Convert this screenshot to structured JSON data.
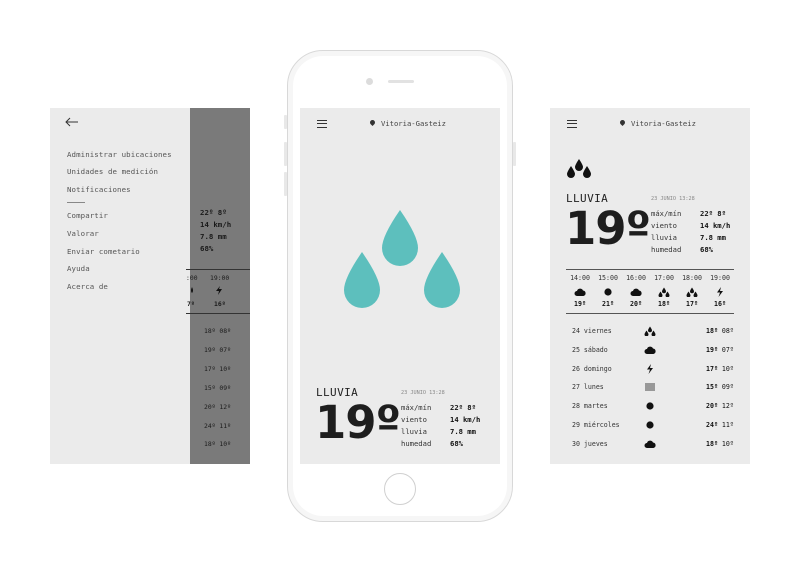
{
  "colors": {
    "drop_teal": "#5dbfbd",
    "screen_bg": "#ebebeb",
    "overlay": "#7a7a7a"
  },
  "icons": {
    "back": "arrow-left-icon",
    "menu": "hamburger-icon",
    "location": "location-pin-icon"
  },
  "drawer": {
    "items": [
      "Administrar ubicaciones",
      "Unidades de medición",
      "Notificaciones"
    ],
    "items2": [
      "Compartir",
      "Valorar",
      "Enviar cometario",
      "Ayuda",
      "Acerca de"
    ],
    "peek": {
      "maxmin": "22º 8º",
      "wind": "14 km/h",
      "rain": "7.8 mm",
      "humidity": "68%",
      "hour": "19:00",
      "hour_temp": "16º",
      "prev_temp": "7º",
      "ranges": [
        "18º 08º",
        "19º 07º",
        "17º 10º",
        "15º 09º",
        "20º 12º",
        "24º 11º",
        "18º 10º"
      ]
    }
  },
  "current": {
    "location": "Vitoria-Gasteiz",
    "condition": "LLUVIA",
    "date": "23 JUNIO 13:28",
    "temp": "19º",
    "labels": {
      "maxmin": "máx/mín",
      "wind": "viento",
      "rain": "lluvia",
      "humidity": "humedad"
    },
    "values": {
      "maxmin": "22º 8º",
      "wind": "14 km/h",
      "rain": "7.8 mm",
      "humidity": "68%"
    }
  },
  "hourly": [
    {
      "time": "14:00",
      "icon": "cloud-icon",
      "temp": "19º"
    },
    {
      "time": "15:00",
      "icon": "sun-icon",
      "temp": "21º"
    },
    {
      "time": "16:00",
      "icon": "cloud-icon",
      "temp": "20º"
    },
    {
      "time": "17:00",
      "icon": "rain-drops-icon",
      "temp": "18º"
    },
    {
      "time": "18:00",
      "icon": "rain-drops-icon",
      "temp": "17º"
    },
    {
      "time": "19:00",
      "icon": "lightning-icon",
      "temp": "16º"
    }
  ],
  "daily": [
    {
      "day": "24 viernes",
      "icon": "rain-drops-icon",
      "max": "18º",
      "min": "08º"
    },
    {
      "day": "25 sábado",
      "icon": "cloud-icon",
      "max": "19º",
      "min": "07º"
    },
    {
      "day": "26 domingo",
      "icon": "lightning-icon",
      "max": "17º",
      "min": "10º"
    },
    {
      "day": "27 lunes",
      "icon": "fog-icon",
      "max": "15º",
      "min": "09º"
    },
    {
      "day": "28 martes",
      "icon": "sun-icon",
      "max": "20º",
      "min": "12º"
    },
    {
      "day": "29 miércoles",
      "icon": "sun-icon",
      "max": "24º",
      "min": "11º"
    },
    {
      "day": "30 jueves",
      "icon": "cloud-icon",
      "max": "18º",
      "min": "10º"
    }
  ]
}
